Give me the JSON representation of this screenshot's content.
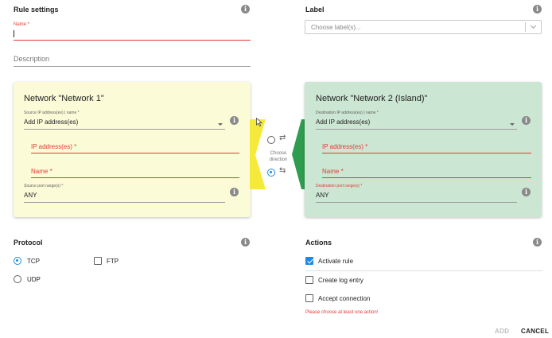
{
  "rule_settings": {
    "title": "Rule settings",
    "name_label": "Name *",
    "name_value": "",
    "description_placeholder": "Description"
  },
  "label_section": {
    "title": "Label",
    "placeholder": "Choose label(s)..."
  },
  "network1": {
    "title": "Network \"Network 1\"",
    "source_ip_label": "Source IP address(es) | name *",
    "source_ip_value": "Add IP address(es)",
    "ip_field_label": "IP address(es) *",
    "name_field_label": "Name *",
    "port_label": "Source port range(s) *",
    "port_value": "ANY",
    "color": "#fbfbd8"
  },
  "network2": {
    "title": "Network \"Network 2 (Island)\"",
    "dest_ip_label": "Destination IP address(es) | name *",
    "dest_ip_value": "Add IP address(es)",
    "ip_field_label": "IP address(es) *",
    "name_field_label": "Name *",
    "port_label": "Destination port range(s) *",
    "port_value": "ANY",
    "color": "#cbe6d2"
  },
  "direction": {
    "label_line1": "Choose",
    "label_line2": "direction",
    "option_right": "⇄",
    "option_left": "⇆",
    "selected": "left"
  },
  "protocol": {
    "title": "Protocol",
    "options": [
      {
        "label": "TCP",
        "selected": true
      },
      {
        "label": "UDP",
        "selected": false
      }
    ],
    "ftp_label": "FTP",
    "ftp_checked": false
  },
  "actions": {
    "title": "Actions",
    "items": [
      {
        "label": "Activate rule",
        "checked": true
      },
      {
        "label": "Create log entry",
        "checked": false
      },
      {
        "label": "Accept connection",
        "checked": false
      }
    ],
    "error": "Please choose at least one action!"
  },
  "footer": {
    "add_label": "ADD",
    "cancel_label": "CANCEL"
  },
  "colors": {
    "accent": "#1e88e5",
    "error": "#e53935",
    "yellow_arrow": "#f5ea3b",
    "green_arrow": "#2e9d4f"
  }
}
